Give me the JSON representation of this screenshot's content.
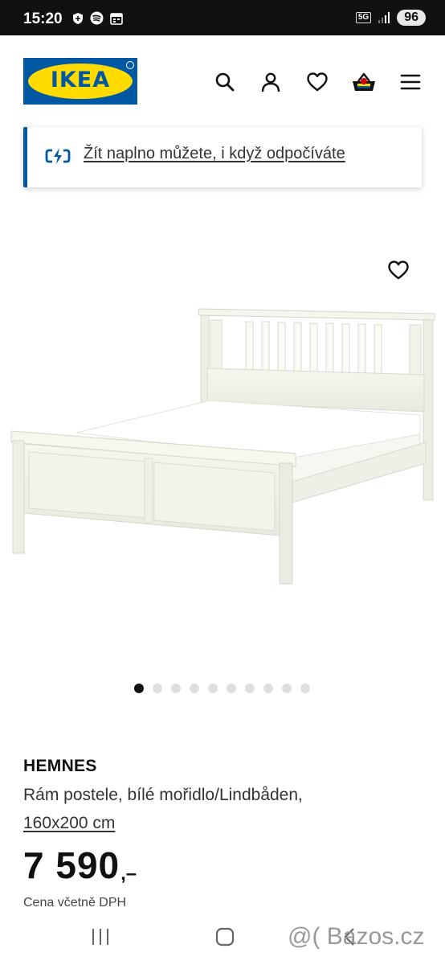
{
  "status_bar": {
    "time": "15:20",
    "network": "5G",
    "battery": "96"
  },
  "header": {
    "logo_text": "IKEA",
    "icons": [
      "search-icon",
      "account-icon",
      "heart-icon",
      "basket-icon",
      "menu-icon"
    ]
  },
  "banner": {
    "link_text": "Žít naplno můžete, i když odpočíváte",
    "icon": "charging-icon"
  },
  "product": {
    "name": "HEMNES",
    "description": "Rám postele, bílé mořidlo/Lindbåden,",
    "size": "160x200 cm",
    "price_integer": "7 590",
    "price_decimal": ",–",
    "vat_note": "Cena včetně DPH",
    "gallery_count": 10,
    "gallery_active_index": 0
  },
  "colors": {
    "ikea_blue": "#0058a3",
    "ikea_yellow": "#ffdb00",
    "status_bar": "#111111"
  },
  "watermark": "@( Bazos.cz"
}
